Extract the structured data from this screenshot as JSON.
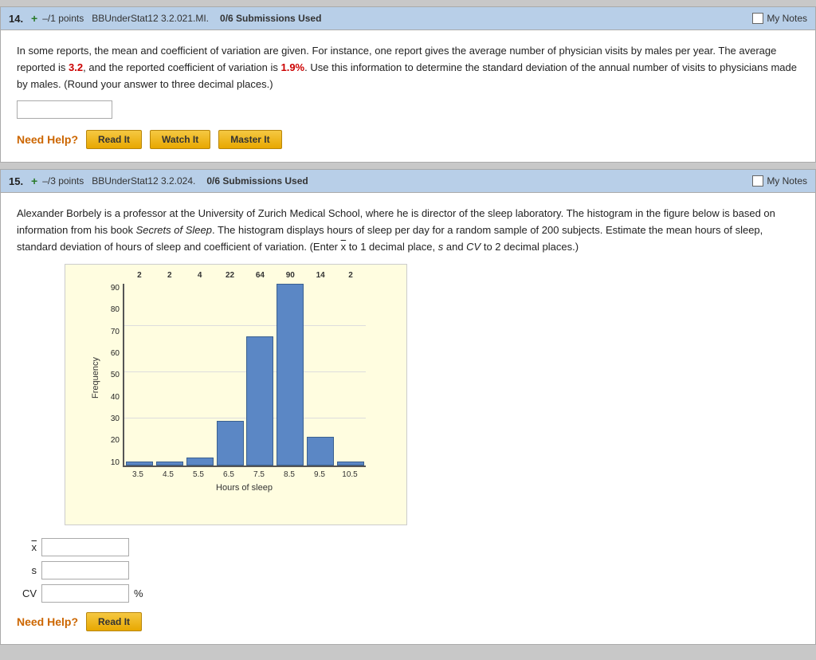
{
  "questions": [
    {
      "number": "14.",
      "points": "–/1 points",
      "course": "BBUnderStat12 3.2.021.MI.",
      "submissions": "0/6 Submissions Used",
      "my_notes": "My Notes",
      "body": "In some reports, the mean and coefficient of variation are given. For instance, one report gives the average number of physician visits by males per year. The average reported is ",
      "mean_value": "3.2",
      "body_mid": ", and the reported coefficient of variation is ",
      "cv_value": "1.9%",
      "body_end": ". Use this information to determine the standard deviation of the annual number of visits to physicians made by males. (Round your answer to three decimal places.)",
      "need_help_label": "Need Help?",
      "buttons": [
        "Read It",
        "Watch It",
        "Master It"
      ]
    },
    {
      "number": "15.",
      "points": "–/3 points",
      "course": "BBUnderStat12 3.2.024.",
      "submissions": "0/6 Submissions Used",
      "my_notes": "My Notes",
      "body_p1": "Alexander Borbely is a professor at the University of Zurich Medical School, where he is director of the sleep laboratory. The histogram in the figure below is based on information from his book ",
      "book_title": "Secrets of Sleep",
      "body_p2": ". The histogram displays hours of sleep per day for a random sample of 200 subjects. Estimate the mean hours of sleep, standard deviation of hours of sleep and coefficient of variation. (Enter ",
      "x_bar_symbol": "x",
      "body_p3": " to 1 decimal place, ",
      "s_symbol": "s",
      "body_p4": " and ",
      "cv_symbol": "CV",
      "body_p5": " to 2 decimal places.)",
      "chart": {
        "y_label": "Frequency",
        "x_label": "Hours of sleep",
        "y_max": 90,
        "bars": [
          {
            "label": "3.5",
            "value": 2,
            "height_pct": 2.22
          },
          {
            "label": "4.5",
            "value": 2,
            "height_pct": 2.22
          },
          {
            "label": "5.5",
            "value": 4,
            "height_pct": 4.44
          },
          {
            "label": "6.5",
            "value": 22,
            "height_pct": 24.4
          },
          {
            "label": "7.5",
            "value": 64,
            "height_pct": 71.1
          },
          {
            "label": "8.5",
            "value": 90,
            "height_pct": 100
          },
          {
            "label": "9.5",
            "value": 14,
            "height_pct": 15.6
          },
          {
            "label": "10.5",
            "value": 2,
            "height_pct": 2.22
          }
        ],
        "x_tick_labels": [
          "3.5",
          "4.5",
          "5.5",
          "6.5",
          "7.5",
          "8.5",
          "9.5",
          "10.5"
        ],
        "y_tick_labels": [
          "10",
          "20",
          "30",
          "40",
          "50",
          "60",
          "70",
          "80",
          "90"
        ]
      },
      "inputs": [
        {
          "id": "x-bar",
          "label_overline": true,
          "label": "x",
          "placeholder": ""
        },
        {
          "id": "s-val",
          "label_overline": false,
          "label": "s",
          "placeholder": ""
        },
        {
          "id": "cv-val",
          "label_overline": false,
          "label": "CV",
          "placeholder": "",
          "suffix": "%"
        }
      ],
      "need_help_label": "Need Help?",
      "buttons": [
        "Read It"
      ]
    }
  ]
}
